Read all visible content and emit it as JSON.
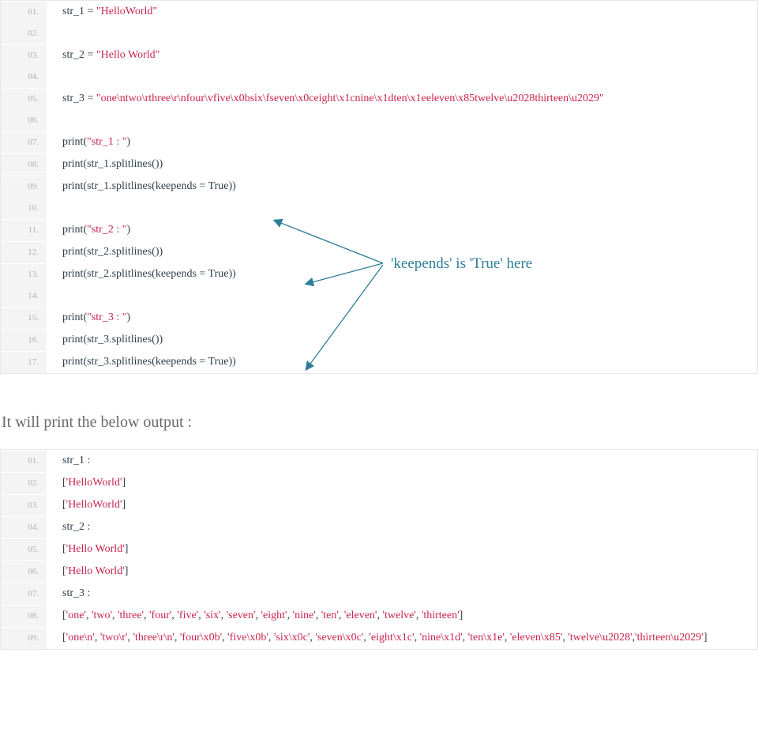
{
  "annotation_text": "'keepends' is 'True' here",
  "narrative": "It will print the below output :",
  "code1": [
    {
      "n": "01.",
      "pre": "str_1 = ",
      "str": "\"HelloWorld\"",
      "post": ""
    },
    {
      "n": "02.",
      "pre": "",
      "str": "",
      "post": ""
    },
    {
      "n": "03.",
      "pre": "str_2 = ",
      "str": "\"Hello World\"",
      "post": ""
    },
    {
      "n": "04.",
      "pre": "",
      "str": "",
      "post": ""
    },
    {
      "n": "05.",
      "pre": "str_3 = ",
      "str": "\"one\\ntwo\\rthree\\r\\nfour\\vfive\\x0bsix\\fseven\\x0ceight\\x1cnine\\x1dten\\x1eeleven\\x85twelve\\u2028thirteen\\u2029\"",
      "post": ""
    },
    {
      "n": "06.",
      "pre": "",
      "str": "",
      "post": ""
    },
    {
      "n": "07.",
      "pre": "print(",
      "str": "\"str_1 : \"",
      "post": ")"
    },
    {
      "n": "08.",
      "pre": "print(str_1.splitlines())",
      "str": "",
      "post": ""
    },
    {
      "n": "09.",
      "pre": "print(str_1.splitlines(keepends = True))",
      "str": "",
      "post": ""
    },
    {
      "n": "10.",
      "pre": "",
      "str": "",
      "post": ""
    },
    {
      "n": "11.",
      "pre": "print(",
      "str": "\"str_2 : \"",
      "post": ")"
    },
    {
      "n": "12.",
      "pre": "print(str_2.splitlines())",
      "str": "",
      "post": ""
    },
    {
      "n": "13.",
      "pre": "print(str_2.splitlines(keepends = True))",
      "str": "",
      "post": ""
    },
    {
      "n": "14.",
      "pre": "",
      "str": "",
      "post": ""
    },
    {
      "n": "15.",
      "pre": "print(",
      "str": "\"str_3 : \"",
      "post": ")"
    },
    {
      "n": "16.",
      "pre": "print(str_3.splitlines())",
      "str": "",
      "post": ""
    },
    {
      "n": "17.",
      "pre": "print(str_3.splitlines(keepends = True))",
      "str": "",
      "post": ""
    }
  ],
  "output1": [
    {
      "n": "01.",
      "segs": [
        {
          "t": "str_1 :",
          "s": false
        }
      ]
    },
    {
      "n": "02.",
      "segs": [
        {
          "t": "[",
          "s": false
        },
        {
          "t": "'HelloWorld'",
          "s": true
        },
        {
          "t": "]",
          "s": false
        }
      ]
    },
    {
      "n": "03.",
      "segs": [
        {
          "t": "[",
          "s": false
        },
        {
          "t": "'HelloWorld'",
          "s": true
        },
        {
          "t": "]",
          "s": false
        }
      ]
    },
    {
      "n": "04.",
      "segs": [
        {
          "t": "str_2 :",
          "s": false
        }
      ]
    },
    {
      "n": "05.",
      "segs": [
        {
          "t": "[",
          "s": false
        },
        {
          "t": "'Hello World'",
          "s": true
        },
        {
          "t": "]",
          "s": false
        }
      ]
    },
    {
      "n": "06.",
      "segs": [
        {
          "t": "[",
          "s": false
        },
        {
          "t": "'Hello World'",
          "s": true
        },
        {
          "t": "]",
          "s": false
        }
      ]
    },
    {
      "n": "07.",
      "segs": [
        {
          "t": "str_3 :",
          "s": false
        }
      ]
    },
    {
      "n": "08.",
      "segs": [
        {
          "t": "[",
          "s": false
        },
        {
          "t": "'one'",
          "s": true
        },
        {
          "t": ", ",
          "s": false
        },
        {
          "t": "'two'",
          "s": true
        },
        {
          "t": ", ",
          "s": false
        },
        {
          "t": "'three'",
          "s": true
        },
        {
          "t": ", ",
          "s": false
        },
        {
          "t": "'four'",
          "s": true
        },
        {
          "t": ", ",
          "s": false
        },
        {
          "t": "'five'",
          "s": true
        },
        {
          "t": ", ",
          "s": false
        },
        {
          "t": "'six'",
          "s": true
        },
        {
          "t": ", ",
          "s": false
        },
        {
          "t": "'seven'",
          "s": true
        },
        {
          "t": ", ",
          "s": false
        },
        {
          "t": "'eight'",
          "s": true
        },
        {
          "t": ", ",
          "s": false
        },
        {
          "t": "'nine'",
          "s": true
        },
        {
          "t": ", ",
          "s": false
        },
        {
          "t": "'ten'",
          "s": true
        },
        {
          "t": ", ",
          "s": false
        },
        {
          "t": "'eleven'",
          "s": true
        },
        {
          "t": ", ",
          "s": false
        },
        {
          "t": "'twelve'",
          "s": true
        },
        {
          "t": ", ",
          "s": false
        },
        {
          "t": "'thirteen'",
          "s": true
        },
        {
          "t": "]",
          "s": false
        }
      ]
    },
    {
      "n": "09.",
      "segs": [
        {
          "t": "[",
          "s": false
        },
        {
          "t": "'one\\n'",
          "s": true
        },
        {
          "t": ", ",
          "s": false
        },
        {
          "t": "'two\\r'",
          "s": true
        },
        {
          "t": ", ",
          "s": false
        },
        {
          "t": "'three\\r\\n'",
          "s": true
        },
        {
          "t": ", ",
          "s": false
        },
        {
          "t": "'four\\x0b'",
          "s": true
        },
        {
          "t": ", ",
          "s": false
        },
        {
          "t": "'five\\x0b'",
          "s": true
        },
        {
          "t": ", ",
          "s": false
        },
        {
          "t": "'six\\x0c'",
          "s": true
        },
        {
          "t": ", ",
          "s": false
        },
        {
          "t": "'seven\\x0c'",
          "s": true
        },
        {
          "t": ", ",
          "s": false
        },
        {
          "t": "'eight\\x1c'",
          "s": true
        },
        {
          "t": ", ",
          "s": false
        },
        {
          "t": "'nine\\x1d'",
          "s": true
        },
        {
          "t": ", ",
          "s": false
        },
        {
          "t": "'ten\\x1e'",
          "s": true
        },
        {
          "t": ", ",
          "s": false
        },
        {
          "t": "'eleven\\x85'",
          "s": true
        },
        {
          "t": ", ",
          "s": false
        },
        {
          "t": "'twelve\\u2028'",
          "s": true
        },
        {
          "t": ",",
          "s": false
        },
        {
          "t": "'thirteen\\u2029'",
          "s": true
        },
        {
          "t": "]",
          "s": false
        }
      ]
    }
  ]
}
